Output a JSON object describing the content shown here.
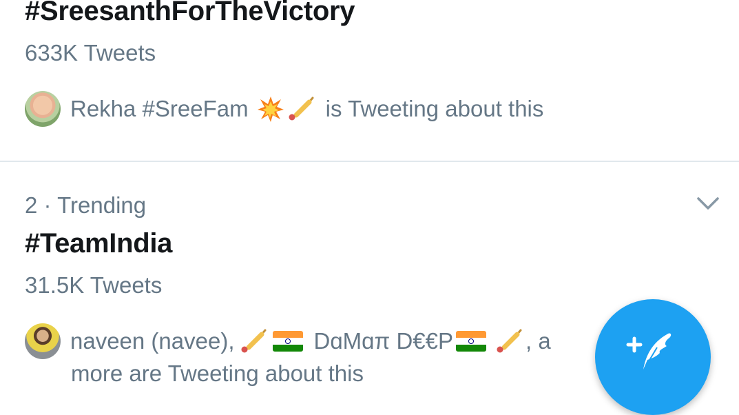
{
  "trends": [
    {
      "hashtag": "#SreesanthForTheVictory",
      "count": "633K Tweets",
      "context": {
        "text_prefix": "Rekha #SreeFam",
        "emojis": [
          "collision-icon",
          "cricket-bat-icon"
        ],
        "text_suffix": "is Tweeting about this"
      }
    },
    {
      "meta": "2 · Trending",
      "hashtag": "#TeamIndia",
      "count": "31.5K Tweets",
      "context": {
        "name1": "naveen (navee),",
        "name2": "DɑMɑπ D€€P",
        "trailing": ", a",
        "line2": "more are Tweeting about this"
      }
    }
  ],
  "icons": {
    "chevron": "chevron-down-icon",
    "compose": "compose-tweet-icon"
  },
  "colors": {
    "accent": "#1da1f2",
    "text_primary": "#14171a",
    "text_secondary": "#657786",
    "divider": "#e1e8ed"
  }
}
